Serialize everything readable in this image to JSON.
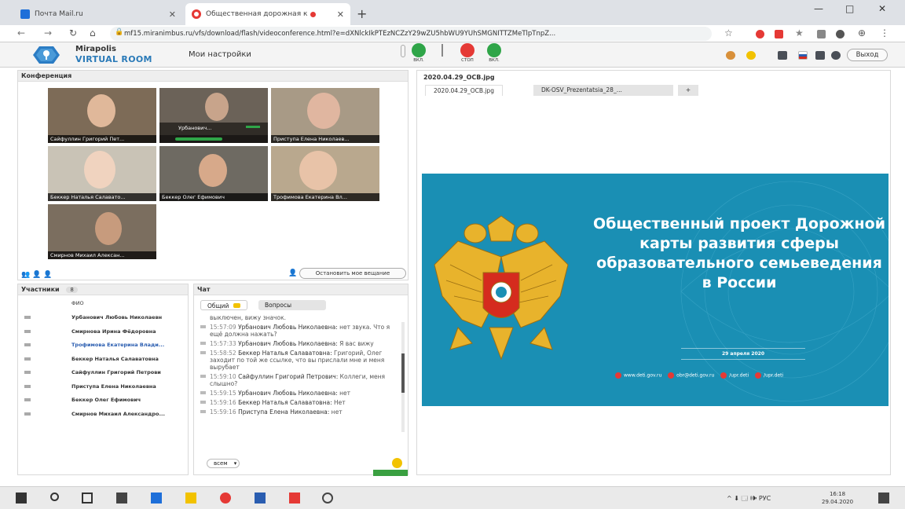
{
  "browser": {
    "tabs": [
      {
        "title": "Почта Mail.ru",
        "color": "#1e6fd9"
      },
      {
        "title": "Общественная дорожная к",
        "color": "#e53935"
      }
    ],
    "new_tab": "+",
    "url": "mf15.miranimbus.ru/vfs/download/flash/videoconference.html?e=dXNlckIkPTEzNCZzY29wZU5hbWU9YUhSMGNITTZMeTlpTnpZ...",
    "window_controls": {
      "minimize": "—",
      "maximize": "□",
      "close": "✕"
    }
  },
  "app": {
    "logo_top": "Mirapolis",
    "logo_bottom": "VIRTUAL ROOM",
    "my_settings": "Мои настройки",
    "controls": [
      {
        "label": "ВКЛ.",
        "color": "#2fa548"
      },
      {
        "label": "СТОП",
        "color": "#e53935"
      },
      {
        "label": "ВКЛ.",
        "color": "#2fa548"
      }
    ],
    "exit": "Выход"
  },
  "conference": {
    "title": "Конференция",
    "videos": [
      {
        "name": "Сайфуллин Григорий Пет...",
        "bg": "#7d6b57",
        "face": "#e0b89a"
      },
      {
        "name": "Урбанович...",
        "bg": "#6b6258",
        "face": "#c8a48b"
      },
      {
        "name": "Приступа Елена Николаев...",
        "bg": "#a89a86",
        "face": "#e0b6a0"
      },
      {
        "name": "Беккер Наталья Салавато...",
        "bg": "#c9c3b6",
        "face": "#f0d3bf"
      },
      {
        "name": "Беккер Олег Ефимович",
        "bg": "#6e6a62",
        "face": "#d7a98a"
      },
      {
        "name": "Трофимова Екатерина Вл...",
        "bg": "#b9a88e",
        "face": "#e8c3a8"
      },
      {
        "name": "Смирнов Михаил Алексан...",
        "bg": "#7b6e5f",
        "face": "#c79b7d"
      }
    ],
    "stop_button": "Остановить мое вещание"
  },
  "participants": {
    "title": "Участники",
    "count": "8",
    "column": "ФИО",
    "items": [
      "Урбанович Любовь Николаевн",
      "Смирнова Ирина Фёдоровна",
      "Трофимова Екатерина Влади...",
      "Беккер Наталья Салаватовна",
      "Сайфуллин Григорий Петрови",
      "Приступа Елена Николаевна",
      "Беккер Олег Ефимович",
      "Смирнов Михаил Александро..."
    ]
  },
  "chat": {
    "title": "Чат",
    "tab_general": "Общий",
    "tab_questions": "Вопросы",
    "messages": [
      {
        "time": "",
        "author": "",
        "text": "выключен, вижу значок."
      },
      {
        "time": "15:57:09",
        "author": "Урбанович Любовь Николаевна:",
        "text": "нет звука. Что я ещё должна нажать?"
      },
      {
        "time": "15:57:33",
        "author": "Урбанович Любовь Николаевна:",
        "text": "Я вас вижу"
      },
      {
        "time": "15:58:52",
        "author": "Беккер Наталья Салаватовна:",
        "text": "Григорий, Олег заходит по той же ссылке, что вы прислали мне и меня вырубает"
      },
      {
        "time": "15:59:10",
        "author": "Сайфуллин Григорий Петрович:",
        "text": "Коллеги, меня слышно?"
      },
      {
        "time": "15:59:15",
        "author": "Урбанович Любовь Николаевна:",
        "text": "нет"
      },
      {
        "time": "15:59:16",
        "author": "Беккер Наталья Салаватовна:",
        "text": "Нет"
      },
      {
        "time": "15:59:16",
        "author": "Приступа Елена Николаевна:",
        "text": "нет"
      }
    ],
    "recipient": "всем"
  },
  "document": {
    "name": "2020.04.29_OCB.jpg",
    "tabs": [
      "2020.04.29_OCB.jpg",
      "DK-OSV_Prezentatsia_28_...",
      "+"
    ],
    "slide": {
      "title": "Общественный проект Дорожной карты развития сферы образовательного семьеведения в России",
      "date": "29 апреля 2020",
      "links": [
        "www.deti.gov.ru",
        "obr@deti.gov.ru",
        "/upr.deti",
        "/upr.deti"
      ],
      "bg_color": "#1a8fb4"
    }
  },
  "taskbar": {
    "tray": "^ ⬇ 🗔 🕪 РУС",
    "time": "16:18",
    "date": "29.04.2020"
  }
}
